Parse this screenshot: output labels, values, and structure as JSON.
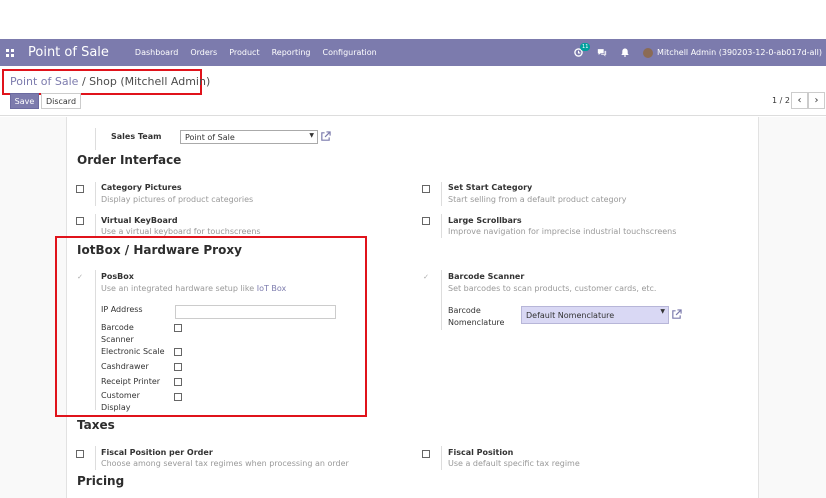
{
  "navbar": {
    "app_name": "Point of Sale",
    "menu": [
      "Dashboard",
      "Orders",
      "Product",
      "Reporting",
      "Configuration"
    ],
    "activity_count": "11",
    "user": "Mitchell Admin (390203-12-0-ab017d-all)"
  },
  "breadcrumb": {
    "parent": "Point of Sale",
    "separator": " / ",
    "current": "Shop (Mitchell Admin)"
  },
  "buttons": {
    "save": "Save",
    "discard": "Discard"
  },
  "pager": {
    "value": "1 / 2",
    "prev": "‹",
    "next": "›"
  },
  "form": {
    "sales_team": {
      "label": "Sales Team",
      "value": "Point of Sale"
    },
    "order_interface": {
      "title": "Order Interface",
      "category_pictures": {
        "label": "Category Pictures",
        "help": "Display pictures of product categories"
      },
      "set_start_category": {
        "label": "Set Start Category",
        "help": "Start selling from a default product category"
      },
      "virtual_keyboard": {
        "label": "Virtual KeyBoard",
        "help": "Use a virtual keyboard for touchscreens"
      },
      "large_scrollbars": {
        "label": "Large Scrollbars",
        "help": "Improve navigation for imprecise industrial touchscreens"
      }
    },
    "iot": {
      "title": "IotBox / Hardware Proxy",
      "posbox": {
        "label": "PosBox",
        "help_prefix": "Use an integrated hardware setup like ",
        "help_link": "IoT Box"
      },
      "barcode_scanner": {
        "label": "Barcode Scanner",
        "help": "Set barcodes to scan products, customer cards, etc."
      },
      "ip_address": {
        "label": "IP Address",
        "value": ""
      },
      "barcode_scanner_field": {
        "label_line1": "Barcode",
        "label_line2": "Scanner"
      },
      "electronic_scale": "Electronic Scale",
      "cashdrawer": "Cashdrawer",
      "receipt_printer": "Receipt Printer",
      "customer_display": {
        "label_line1": "Customer",
        "label_line2": "Display"
      },
      "barcode_nomenclature": {
        "label_line1": "Barcode",
        "label_line2": "Nomenclature",
        "value": "Default Nomenclature"
      }
    },
    "taxes": {
      "title": "Taxes",
      "fiscal_position_per_order": {
        "label": "Fiscal Position per Order",
        "help": "Choose among several tax regimes when processing an order"
      },
      "fiscal_position": {
        "label": "Fiscal Position",
        "help": "Use a default specific tax regime"
      }
    },
    "pricing": {
      "title": "Pricing"
    }
  },
  "colors": {
    "navbar": "#7c7bad",
    "highlight": "#e0131b",
    "nomenclature_bg": "#d9d8f4"
  }
}
